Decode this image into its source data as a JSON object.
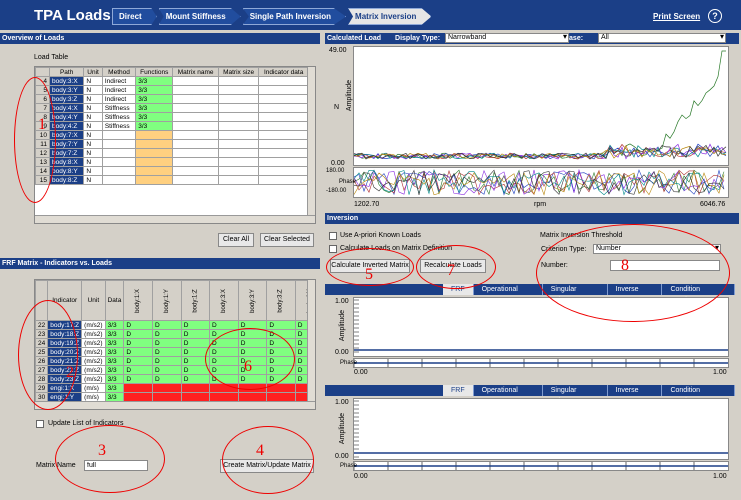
{
  "app": {
    "title": "TPA Loads",
    "print_label": "Print Screen",
    "help_label": "?"
  },
  "breadcrumbs": [
    "Direct",
    "Mount Stiffness",
    "Single Path Inversion",
    "Matrix Inversion"
  ],
  "overview": {
    "header": "Overview of Loads",
    "table_label": "Load Table",
    "columns": [
      "Path",
      "Unit",
      "Method",
      "Functions",
      "Matrix name",
      "Matrix size",
      "Indicator data"
    ],
    "rows": [
      {
        "n": "4",
        "path": "body:3:X",
        "unit": "N",
        "method": "Indirect",
        "functions": "3/3"
      },
      {
        "n": "5",
        "path": "body:3:Y",
        "unit": "N",
        "method": "Indirect",
        "functions": "3/3"
      },
      {
        "n": "6",
        "path": "body:3:Z",
        "unit": "N",
        "method": "Indirect",
        "functions": "3/3"
      },
      {
        "n": "7",
        "path": "body:4:X",
        "unit": "N",
        "method": "Stiffness",
        "functions": "3/3"
      },
      {
        "n": "8",
        "path": "body:4:Y",
        "unit": "N",
        "method": "Stiffness",
        "functions": "3/3"
      },
      {
        "n": "9",
        "path": "body:4:Z",
        "unit": "N",
        "method": "Stiffness",
        "functions": "3/3"
      },
      {
        "n": "10",
        "path": "body:7:X",
        "unit": "N",
        "method": "",
        "functions": ""
      },
      {
        "n": "11",
        "path": "body:7:Y",
        "unit": "N",
        "method": "",
        "functions": ""
      },
      {
        "n": "12",
        "path": "body:7:Z",
        "unit": "N",
        "method": "",
        "functions": ""
      },
      {
        "n": "13",
        "path": "body:8:X",
        "unit": "N",
        "method": "",
        "functions": ""
      },
      {
        "n": "14",
        "path": "body:8:Y",
        "unit": "N",
        "method": "",
        "functions": ""
      },
      {
        "n": "15",
        "path": "body:8:Z",
        "unit": "N",
        "method": "",
        "functions": ""
      }
    ],
    "clear_all": "Clear All",
    "clear_selected": "Clear Selected"
  },
  "frf": {
    "header": "FRF Matrix - Indicators vs. Loads",
    "columns": [
      "Indicator",
      "Unit",
      "Data"
    ],
    "load_columns": [
      "body:1:X",
      "body:1:Y",
      "body:1:Z",
      "body:3:X",
      "body:3:Y",
      "body:3:Z",
      "body:4:X",
      "body:4:Y",
      "body:4:Z",
      "body:7:X",
      "body:7:Y"
    ],
    "rows": [
      {
        "n": "22",
        "ind": "body:17:Z",
        "unit": "(m/s2)",
        "data": "3/3",
        "ok": true
      },
      {
        "n": "23",
        "ind": "body:18:Z",
        "unit": "(m/s2)",
        "data": "3/3",
        "ok": true
      },
      {
        "n": "24",
        "ind": "body:19:Z",
        "unit": "(m/s2)",
        "data": "3/3",
        "ok": true
      },
      {
        "n": "25",
        "ind": "body:20:Z",
        "unit": "(m/s2)",
        "data": "3/3",
        "ok": true
      },
      {
        "n": "26",
        "ind": "body:21:Z",
        "unit": "(m/s2)",
        "data": "3/3",
        "ok": true
      },
      {
        "n": "27",
        "ind": "body:22:Z",
        "unit": "(m/s2)",
        "data": "3/3",
        "ok": true
      },
      {
        "n": "28",
        "ind": "body:23:Z",
        "unit": "(m/s2)",
        "data": "3/3",
        "ok": true
      },
      {
        "n": "29",
        "ind": "engi:1:X",
        "unit": "(m/s)",
        "data": "3/3",
        "ok": false
      },
      {
        "n": "30",
        "ind": "engi:1:Y",
        "unit": "(m/s)",
        "data": "3/3",
        "ok": false
      },
      {
        "n": "31",
        "ind": "engi:1:Z",
        "unit": "(m/s)",
        "data": "3/3",
        "ok": false
      }
    ],
    "cell_value": "D",
    "update_label": "Update List of Indicators",
    "matrix_name_label": "Matrix Name",
    "matrix_name_value": "full",
    "create_button": "Create Matrix/Update Matrix"
  },
  "calculated": {
    "header": "Calculated Load",
    "display_type_label": "Display Type:",
    "display_type_value": "Narrowband",
    "case_label": "Case:",
    "case_value": "All",
    "y_top": "49.00",
    "y_zero": "0.00",
    "y_label": "Amplitude",
    "y_unit": "N",
    "phase_top": "180.00",
    "phase_bottom": "-180.00",
    "phase_label": "Phase",
    "x_min": "1202.70",
    "x_max": "6046.76",
    "x_label": "rpm"
  },
  "inversion": {
    "header": "Inversion",
    "apriori_label": "Use A-priori Known Loads",
    "calc_on_def_label": "Calculate Loads on Matrix Definition",
    "calc_inverted": "Calculate Inverted Matrix",
    "recalculate": "Recalculate Loads",
    "threshold_label": "Matrix Inversion Threshold",
    "criterion_label": "Criterion Type:",
    "criterion_value": "Number",
    "number_label": "Number:",
    "number_value": ""
  },
  "tabs": [
    "FRF",
    "Operational Data",
    "Singular Values",
    "Inverse FRF",
    "Condition Number"
  ],
  "subplot": {
    "y_top": "1.00",
    "y_zero": "0.00",
    "y_label": "Amplitude",
    "phase_label": "Phase",
    "x_min": "0.00",
    "x_max": "1.00"
  },
  "annotations": [
    "1",
    "2",
    "3",
    "4",
    "5",
    "6",
    "7",
    "8"
  ]
}
